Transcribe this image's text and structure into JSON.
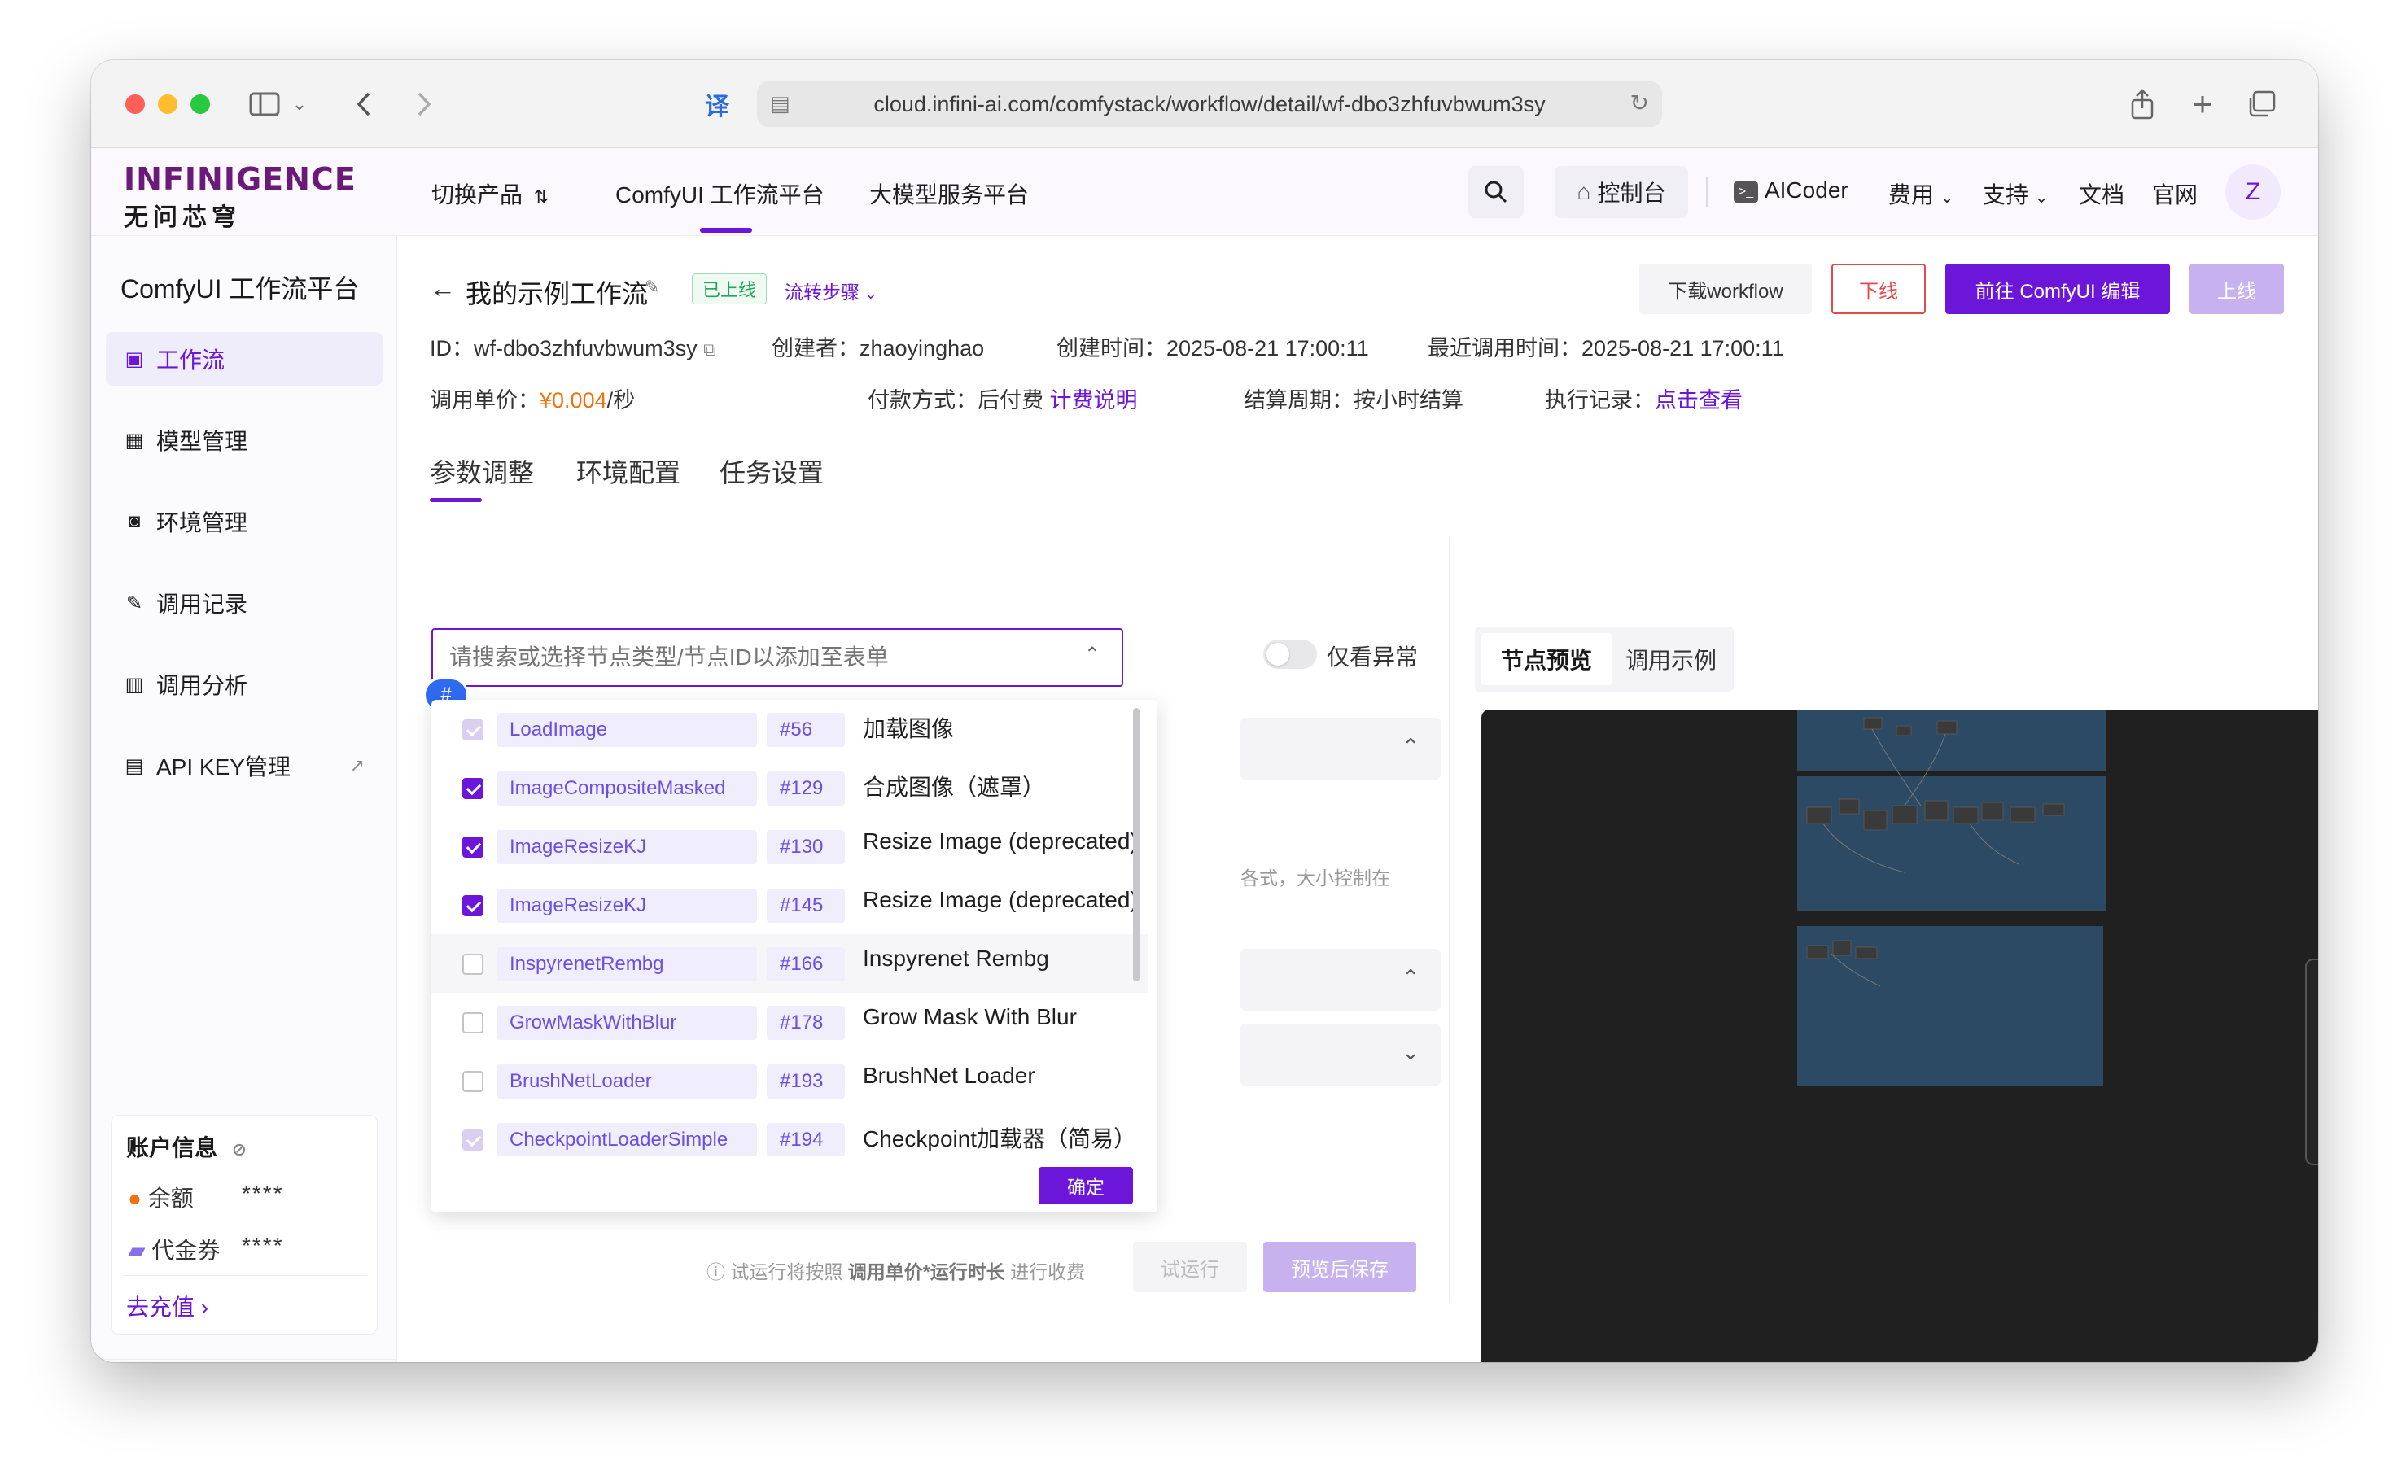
{
  "browser": {
    "url": "cloud.infini-ai.com/comfystack/workflow/detail/wf-dbo3zhfuvbwum3sy",
    "colors": {
      "close": "#fe5f57",
      "minimize": "#febc2e",
      "zoom": "#28c840"
    }
  },
  "header": {
    "logo_en": "INFINIGENCE",
    "logo_cn": "无问芯穹",
    "switch_product": "切换产品",
    "nav_comfy": "ComfyUI 工作流平台",
    "nav_llm": "大模型服务平台",
    "console": "控制台",
    "aicoder": "AICoder",
    "fees": "费用",
    "support": "支持",
    "docs": "文档",
    "official": "官网",
    "avatar": "Z"
  },
  "sidebar": {
    "title": "ComfyUI 工作流平台",
    "items": [
      {
        "label": "工作流"
      },
      {
        "label": "模型管理"
      },
      {
        "label": "环境管理"
      },
      {
        "label": "调用记录"
      },
      {
        "label": "调用分析"
      },
      {
        "label": "API KEY管理"
      }
    ],
    "account": {
      "title": "账户信息",
      "balance_label": "余额",
      "balance_value": "****",
      "voucher_label": "代金券",
      "voucher_value": "****",
      "recharge": "去充值"
    }
  },
  "workflow": {
    "title": "我的示例工作流",
    "status": "已上线",
    "flow_steps": "流转步骤",
    "btn_download": "下载workflow",
    "btn_offline": "下线",
    "btn_edit": "前往 ComfyUI 编辑",
    "btn_online": "上线",
    "id_label": "ID：",
    "id_value": "wf-dbo3zhfuvbwum3sy",
    "creator_label": "创建者：",
    "creator_value": "zhaoyinghao",
    "created_label": "创建时间：",
    "created_value": "2025-08-21 17:00:11",
    "last_call_label": "最近调用时间：",
    "last_call_value": "2025-08-21 17:00:11",
    "price_label": "调用单价：",
    "price_currency": "¥",
    "price_value": "0.004",
    "price_unit": "/秒",
    "pay_label": "付款方式：",
    "pay_value": "后付费",
    "pay_link": "计费说明",
    "cycle_label": "结算周期：",
    "cycle_value": "按小时结算",
    "exec_label": "执行记录：",
    "exec_link": "点击查看"
  },
  "tabs": [
    "参数调整",
    "环境配置",
    "任务设置"
  ],
  "node_select": {
    "placeholder": "请搜索或选择节点类型/节点ID以添加至表单",
    "badge": "#",
    "only_error": "仅看异常",
    "confirm": "确定",
    "options": [
      {
        "type": "LoadImage",
        "id": "#56",
        "name": "加载图像",
        "state": "disabled"
      },
      {
        "type": "ImageCompositeMasked",
        "id": "#129",
        "name": "合成图像（遮罩）",
        "state": "checked"
      },
      {
        "type": "ImageResizeKJ",
        "id": "#130",
        "name": "Resize Image (deprecated)",
        "state": "checked"
      },
      {
        "type": "ImageResizeKJ",
        "id": "#145",
        "name": "Resize Image (deprecated)",
        "state": "checked"
      },
      {
        "type": "InspyrenetRembg",
        "id": "#166",
        "name": "Inspyrenet Rembg",
        "state": "unchecked"
      },
      {
        "type": "GrowMaskWithBlur",
        "id": "#178",
        "name": "Grow Mask With Blur",
        "state": "unchecked"
      },
      {
        "type": "BrushNetLoader",
        "id": "#193",
        "name": "BrushNet Loader",
        "state": "unchecked"
      },
      {
        "type": "CheckpointLoaderSimple",
        "id": "#194",
        "name": "Checkpoint加载器（简易）",
        "state": "disabled"
      }
    ]
  },
  "behind_text": "各式，大小控制在",
  "footer": {
    "note_prefix": "试运行将按照",
    "note_bold": "调用单价*运行时长",
    "note_suffix": "进行收费",
    "btn_trial": "试运行",
    "btn_preview_save": "预览后保存"
  },
  "preview": {
    "tab_node": "节点预览",
    "tab_example": "调用示例"
  },
  "colors": {
    "accent": "#6b16d8",
    "price": "#f5700a",
    "status_green": "#23a55a",
    "offline_red": "#e5484d"
  }
}
